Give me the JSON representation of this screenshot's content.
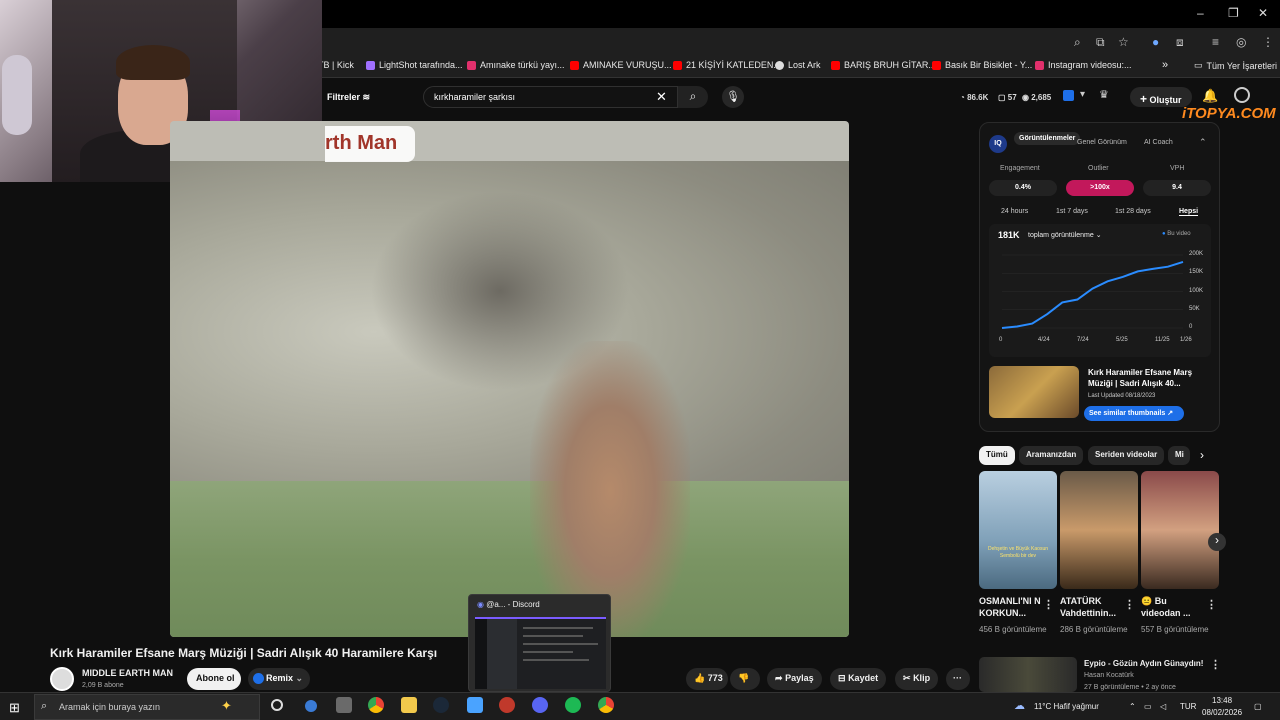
{
  "browser": {
    "window_controls": [
      "–",
      "❐",
      "✕"
    ],
    "bookmarks": [
      {
        "label": "TB | Kick",
        "color": "#53fc18"
      },
      {
        "label": "LightShot tarafında...",
        "color": "#a070ff"
      },
      {
        "label": "Amınake türkü yayı...",
        "color": "#e1306c"
      },
      {
        "label": "AMINAKE VURUŞU...",
        "color": "#ff0000"
      },
      {
        "label": "21 KİŞİYİ KATLEDEN...",
        "color": "#ff0000"
      },
      {
        "label": "Lost Ark",
        "color": "#dddddd"
      },
      {
        "label": "BARIŞ BRUH GİTAR...",
        "color": "#ff0000"
      },
      {
        "label": "Basık Bir Bisiklet - Y...",
        "color": "#ff0000"
      },
      {
        "label": "Instagram videosu:...",
        "color": "#e1306c"
      }
    ],
    "bookmarks_more": "»",
    "all_bookmarks": "Tüm Yer İşaretleri"
  },
  "youtube": {
    "filters_label": "Filtreler",
    "search_value": "kırkharamiler şarkısı",
    "stats": [
      "86.6K",
      "57",
      "2,685"
    ],
    "create_label": "Oluştur",
    "logo_text": "iTOPYA.COM"
  },
  "video": {
    "watermark": "rth Man",
    "title": "Kırk Haramiler Efsane Marş Müziği | Sadri Alışık 40 Haramilere Karşı",
    "channel": "MIDDLE EARTH MAN",
    "subscribers": "2,09 B abone",
    "subscribe_label": "Abone ol",
    "remix_label": "Remix",
    "likes": "773",
    "share_label": "Paylaş",
    "save_label": "Kaydet",
    "clip_label": "Klip"
  },
  "extension": {
    "tabs": [
      "Görüntülenmeler",
      "Genel Görünüm",
      "AI Coach"
    ],
    "metrics": [
      {
        "label": "Engagement",
        "value": "0.4%"
      },
      {
        "label": "Outlier",
        "value": ">100x"
      },
      {
        "label": "VPH",
        "value": "9.4"
      }
    ],
    "periods": [
      "24 hours",
      "1st 7 days",
      "1st 28 days",
      "Hepsi"
    ],
    "total_views": "181K",
    "views_dropdown": "toplam görüntülenme",
    "legend": "Bu video",
    "card_title": "Kırk Haramiler Efsane Marş Müziği | Sadri Alışık 40...",
    "card_updated": "Last Updated 08/18/2023",
    "similar_btn": "See similar thumbnails"
  },
  "chart_data": {
    "type": "line",
    "x_ticks": [
      "0",
      "4/24",
      "7/24",
      "5/25",
      "11/25",
      "1/26"
    ],
    "y_ticks": [
      "0",
      "50K",
      "100K",
      "150K",
      "200K"
    ],
    "ylim": [
      0,
      200000
    ],
    "series": [
      {
        "name": "Bu video",
        "values": [
          0,
          4000,
          12000,
          38000,
          70000,
          78000,
          108000,
          128000,
          140000,
          155000,
          162000,
          168000,
          181000
        ]
      }
    ]
  },
  "chips": [
    "Tümü",
    "Aramanızdan",
    "Seriden videolar",
    "Mi"
  ],
  "shorts": [
    {
      "title": "OSMANLI'NI N KORKUN...",
      "views": "456 B görüntüleme",
      "overlay": "Dehşetin ve Büyük Kaosun Sembolü bir dev"
    },
    {
      "title": "ATATÜRK Vahdettinin...",
      "views": "286 B görüntüleme",
      "overlay": ""
    },
    {
      "title": "😐 Bu videodan ...",
      "views": "557 B görüntüleme",
      "overlay": ""
    }
  ],
  "next_video": {
    "title": "Eypio - Gözün Aydın Günaydın!",
    "channel": "Hasan Kocatürk",
    "meta": "27 B görüntüleme • 2 ay önce"
  },
  "discord_popup": "@a... - Discord",
  "taskbar": {
    "search_placeholder": "Aramak için buraya yazın",
    "weather": "11°C  Hafif yağmur",
    "lang": "TUR",
    "time": "13:48",
    "date": "08/02/2026"
  }
}
